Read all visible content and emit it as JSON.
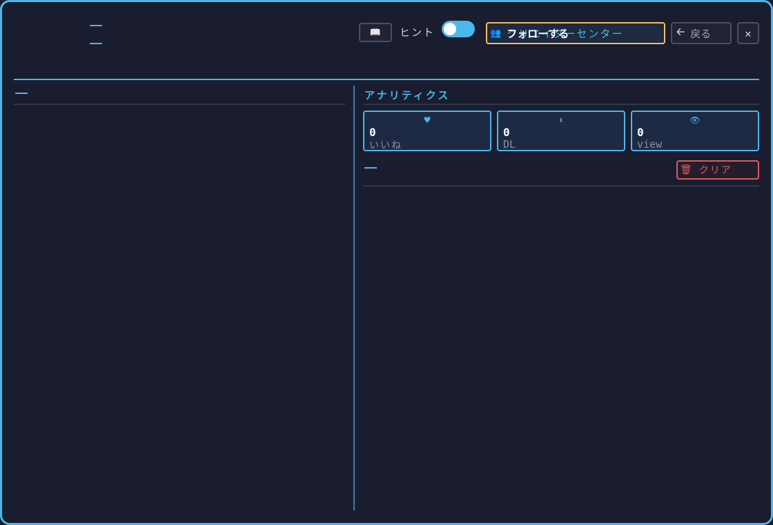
{
  "header": {
    "guide_icon": "book-icon",
    "hint_label": "ヒント",
    "hint_toggle_on": true,
    "follow_button": {
      "icon": "users-icon",
      "label": "フォローする",
      "underlying_label": "クリエイターセンター"
    },
    "back_button": {
      "icon": "arrow-left-icon",
      "label": "戻る"
    },
    "close_icon": "close-icon"
  },
  "analytics": {
    "title": "アナリティクス",
    "stats": [
      {
        "icon": "heart-icon",
        "glyph": "♥",
        "value": "0",
        "label": "いいね"
      },
      {
        "icon": "download-icon",
        "glyph": "⬇",
        "value": "0",
        "label": "DL"
      },
      {
        "icon": "eye-icon",
        "glyph": "👁",
        "value": "0",
        "label": "view"
      }
    ],
    "clear_button": {
      "icon": "trash-icon",
      "label": "クリア"
    }
  },
  "colors": {
    "accent": "#49b8ee",
    "background": "#1a1d2f",
    "follow_border": "#f2c060",
    "danger": "#e05a5a"
  }
}
